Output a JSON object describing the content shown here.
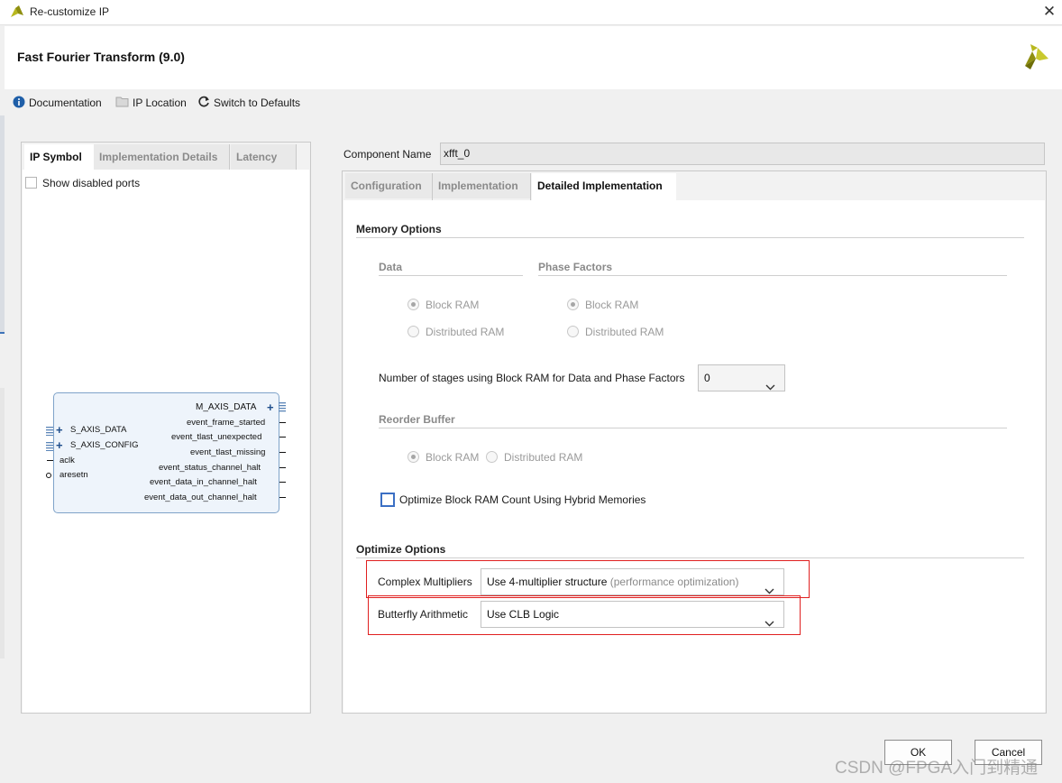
{
  "window": {
    "title": "Re-customize IP",
    "close_glyph": "✕"
  },
  "header": {
    "title": "Fast Fourier Transform (9.0)"
  },
  "toolbar": {
    "documentation": "Documentation",
    "ip_location": "IP Location",
    "switch_defaults": "Switch to Defaults"
  },
  "left_panel": {
    "tabs": [
      "IP Symbol",
      "Implementation Details",
      "Latency"
    ],
    "show_disabled_ports": "Show disabled ports"
  },
  "symbol": {
    "left_ports": [
      "S_AXIS_DATA",
      "S_AXIS_CONFIG",
      "aclk",
      "aresetn"
    ],
    "right_ports": [
      "M_AXIS_DATA",
      "event_frame_started",
      "event_tlast_unexpected",
      "event_tlast_missing",
      "event_status_channel_halt",
      "event_data_in_channel_halt",
      "event_data_out_channel_halt"
    ]
  },
  "component": {
    "label": "Component Name",
    "value": "xfft_0"
  },
  "right_tabs": [
    "Configuration",
    "Implementation",
    "Detailed Implementation"
  ],
  "memory": {
    "title": "Memory Options",
    "data_title": "Data",
    "phase_title": "Phase Factors",
    "block_ram": "Block RAM",
    "distributed_ram": "Distributed RAM",
    "stages_label": "Number of stages using Block RAM for Data and Phase Factors",
    "stages_value": "0",
    "reorder_title": "Reorder Buffer",
    "hybrid_label": "Optimize Block RAM Count Using Hybrid Memories"
  },
  "optimize": {
    "title": "Optimize Options",
    "complex_label": "Complex Multipliers",
    "complex_value": "Use 4-multiplier structure",
    "complex_hint": "(performance optimization)",
    "butterfly_label": "Butterfly Arithmetic",
    "butterfly_value": "Use CLB Logic"
  },
  "buttons": {
    "ok": "OK",
    "cancel": "Cancel"
  },
  "watermark": "CSDN @FPGA入门到精通",
  "colors": {
    "accent_red": "#e02020",
    "symbol_border": "#7fa3c9",
    "symbol_fill": "#eef4fb",
    "info_blue": "#1f5fa8",
    "brand_olive": "#a9a92a"
  }
}
